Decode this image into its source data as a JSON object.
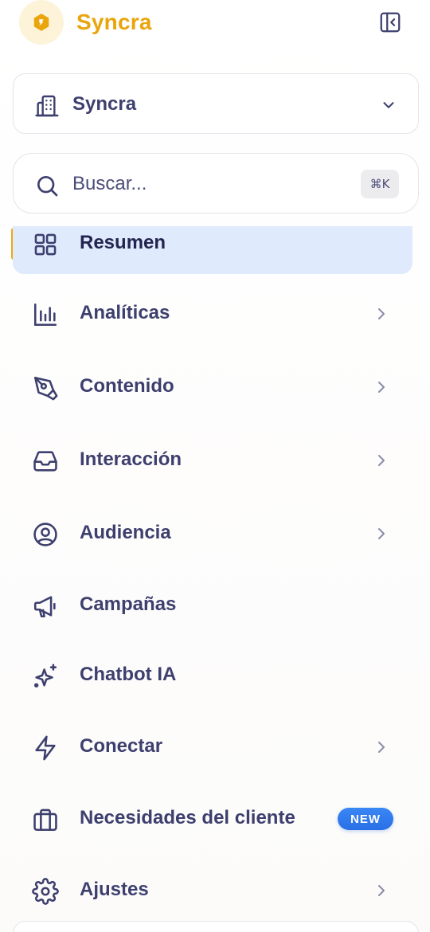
{
  "header": {
    "brand": "Syncra",
    "logo_icon": "hexagon-logo-icon",
    "collapse_icon": "sidebar-collapse-icon"
  },
  "workspace": {
    "label": "Syncra",
    "icon": "building-icon",
    "chevron": "chevron-down-icon"
  },
  "search": {
    "placeholder": "Buscar...",
    "value": "",
    "shortcut": "⌘K"
  },
  "nav": {
    "items": [
      {
        "label": "Resumen",
        "icon": "grid-icon",
        "active": true,
        "chevron": false
      },
      {
        "label": "Analíticas",
        "icon": "bar-chart-icon",
        "chevron": true
      },
      {
        "label": "Contenido",
        "icon": "pen-tool-icon",
        "chevron": true
      },
      {
        "label": "Interacción",
        "icon": "inbox-icon",
        "chevron": true
      },
      {
        "label": "Audiencia",
        "icon": "user-circle-icon",
        "chevron": true
      },
      {
        "label": "Campañas",
        "icon": "megaphone-icon",
        "chevron": false
      },
      {
        "label": "Chatbot IA",
        "icon": "sparkles-icon",
        "chevron": false
      },
      {
        "label": "Conectar",
        "icon": "zap-icon",
        "chevron": true
      },
      {
        "label": "Necesidades del cliente",
        "icon": "briefcase-icon",
        "chevron": false,
        "badge": "NEW"
      },
      {
        "label": "Ajustes",
        "icon": "gear-icon",
        "chevron": true
      }
    ]
  },
  "colors": {
    "brand": "#eaa50d",
    "text": "#3d3f6e",
    "active_bg": "#dfeafd",
    "active_bar": "#f1a90a",
    "badge": "#2f78ee"
  }
}
